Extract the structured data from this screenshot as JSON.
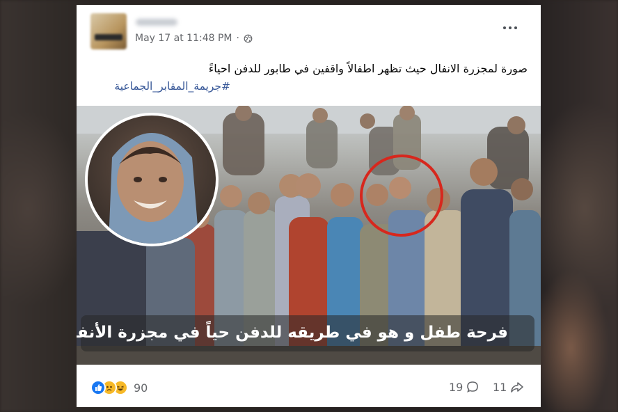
{
  "post": {
    "timestamp": "May 17 at 11:48 PM",
    "separator": "·",
    "audience_icon": "globe-icon",
    "more_icon": "more-horizontal-icon",
    "text": "صورة لمجزرة الانفال حيث تظهر اطفالاً واقفين في طابور للدفن احياءً",
    "hashtag": "#جريمة_المقابر_الجماعية"
  },
  "image": {
    "caption": "فرحة طفل و هو في طريقه للدفن حياً في مجزرة الأنفال",
    "highlight_color": "#d7271d"
  },
  "footer": {
    "reaction_icons": [
      "like-icon",
      "sad-icon",
      "haha-icon"
    ],
    "reaction_count": "90",
    "comment_count": "19",
    "share_count": "11"
  },
  "colors": {
    "link": "#385898",
    "secondary_text": "#65676b",
    "like_blue": "#1877f2"
  }
}
